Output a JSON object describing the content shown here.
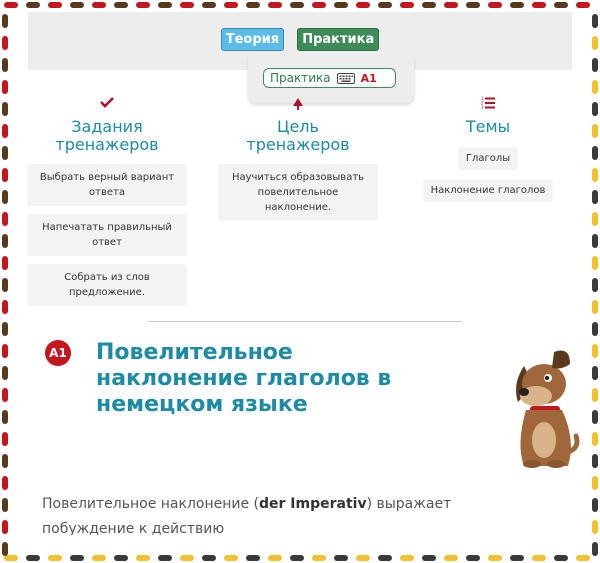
{
  "nav": {
    "theory_label": "Теория",
    "practice_label": "Практика"
  },
  "dropdown": {
    "label": "Практика",
    "level": "A1",
    "icon": "keyboard-icon"
  },
  "columns": [
    {
      "icon": "checkmark-icon",
      "title_line1": "Задания",
      "title_line2": "тренажеров",
      "items": [
        "Выбрать верный вариант ответа",
        "Напечатать правильный ответ",
        "Собрать из слов предложение."
      ]
    },
    {
      "icon": "target-icon",
      "title_line1": "Цель",
      "title_line2": "тренажеров",
      "items": [
        "Научиться образовывать повелительное наклонение."
      ]
    },
    {
      "icon": "numbered-list-icon",
      "title_line1": "Темы",
      "items": [
        "Глаголы",
        "Наклонение глаголов"
      ]
    }
  ],
  "article": {
    "level_badge": "A1",
    "title": "Повелительное наклонение глаголов в немецком языке",
    "intro_before": "Повелительное наклонение (",
    "intro_bold": "der Imperativ",
    "intro_after": ") выражает",
    "intro_line2": "побуждение к действию"
  },
  "colors": {
    "accent_blue": "#1e8ba5",
    "practice_green": "#3d8c57",
    "theory_blue": "#5bbde7",
    "level_red": "#c4161c"
  }
}
